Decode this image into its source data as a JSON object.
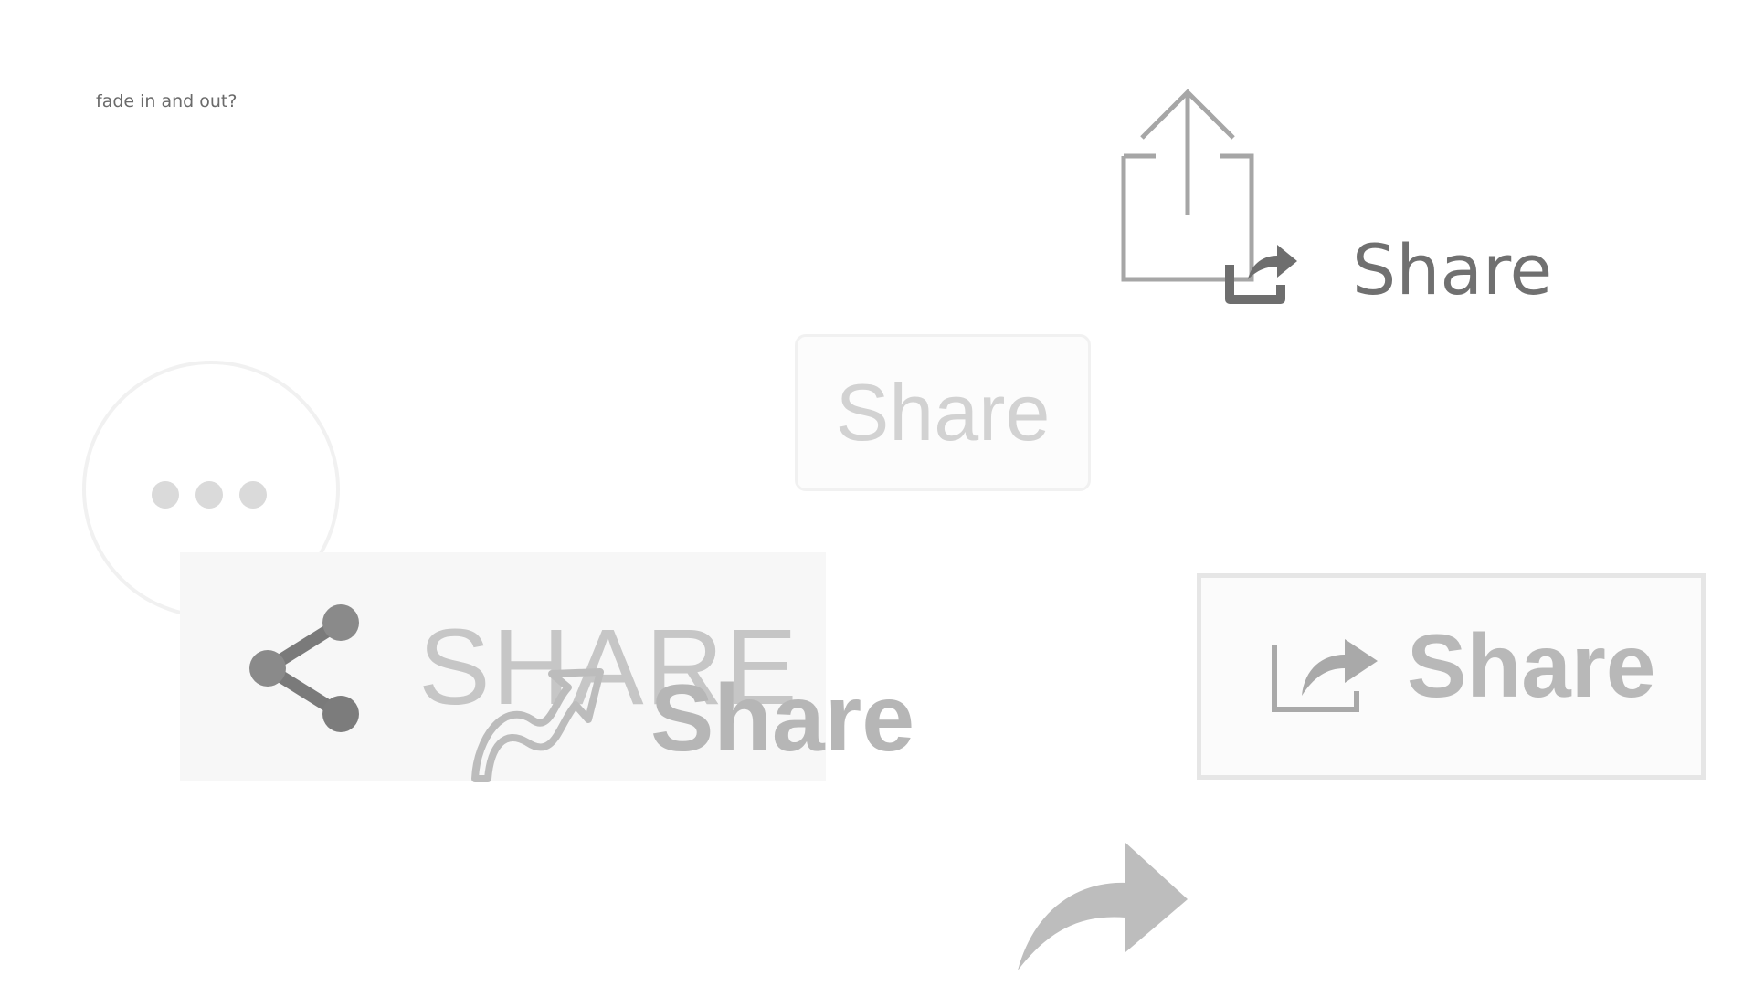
{
  "note": {
    "text": "fade in and out?"
  },
  "top_icon_label": "Share",
  "ghost_button": {
    "label": "Share"
  },
  "more_button": {
    "icon": "more-horizontal-icon"
  },
  "share_panel": {
    "label": "SHARE",
    "icon": "share-graph-icon"
  },
  "curvy_share": {
    "label": "Share",
    "icon": "curved-arrow-icon"
  },
  "outline_button": {
    "label": "Share",
    "icon": "box-arrow-share-icon"
  },
  "bottom_icon": "forward-arrow-icon",
  "colors": {
    "dark_icon": "#707070",
    "mid_gray": "#b8b8b8",
    "light_gray": "#d2d2d2",
    "panel_bg": "#f7f7f7"
  }
}
